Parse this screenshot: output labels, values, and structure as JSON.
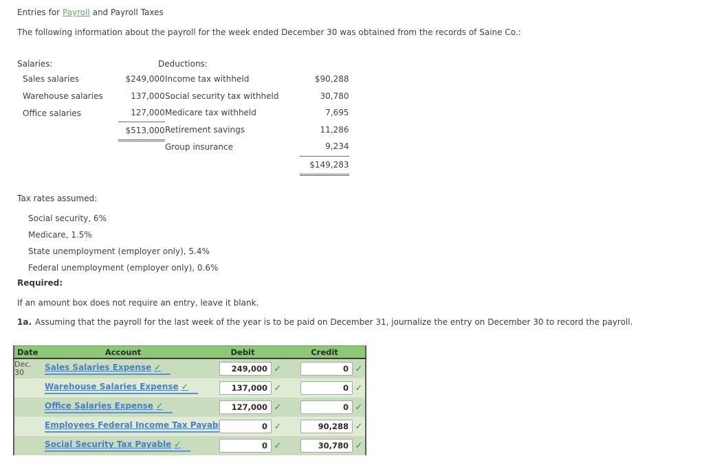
{
  "header": {
    "title_prefix": "Entries for ",
    "title_link": "Payroll",
    "title_suffix": " and Payroll Taxes",
    "intro": "The following information about the payroll for the week ended December 30 was obtained from the records of Saine Co.:",
    "link_color": "#5fae5f"
  },
  "salaries": {
    "heading": "Salaries:",
    "rows": [
      {
        "label": "Sales salaries",
        "amount": "$249,000"
      },
      {
        "label": "Warehouse salaries",
        "amount": "137,000"
      },
      {
        "label": "Office salaries",
        "amount": "127,000"
      }
    ],
    "total": "$513,000"
  },
  "deductions": {
    "heading": "Deductions:",
    "rows": [
      {
        "label": "Income tax withheld",
        "amount": "$90,288"
      },
      {
        "label": "Social security tax withheld",
        "amount": "30,780"
      },
      {
        "label": "Medicare tax withheld",
        "amount": "7,695"
      },
      {
        "label": "Retirement savings",
        "amount": "11,286"
      },
      {
        "label": "Group insurance",
        "amount": "9,234"
      }
    ],
    "total": "$149,283"
  },
  "tax_rates": {
    "heading": "Tax rates assumed:",
    "items": [
      "Social security, 6%",
      "Medicare, 1.5%",
      "State unemployment (employer only), 5.4%",
      "Federal unemployment (employer only), 0.6%"
    ]
  },
  "required": {
    "heading": "Required:",
    "note": "If an amount box does not require an entry, leave it blank.",
    "question_number": "1a.",
    "question_text": "Assuming that the payroll for the last week of the year is to be paid on December 31, journalize the entry on December 30 to record the payroll."
  },
  "journal": {
    "columns": {
      "date": "Date",
      "account": "Account",
      "debit": "Debit",
      "credit": "Credit"
    },
    "date_line1": "Dec.",
    "date_line2": "30",
    "check_glyph": "✓",
    "colors": {
      "header_green": "#8cc878",
      "row_dark": "#c9dcbe",
      "row_light": "#dfebd4",
      "account_link": "#4a7fc1",
      "check_green": "#2e9440"
    },
    "rows": [
      {
        "account": "Sales Salaries Expense",
        "debit": "249,000",
        "credit": "0"
      },
      {
        "account": "Warehouse Salaries Expense",
        "debit": "137,000",
        "credit": "0"
      },
      {
        "account": "Office Salaries Expense",
        "debit": "127,000",
        "credit": "0"
      },
      {
        "account": "Employees Federal Income Tax Payable",
        "debit": "0",
        "credit": "90,288"
      },
      {
        "account": "Social Security Tax Payable",
        "debit": "0",
        "credit": "30,780"
      }
    ]
  }
}
